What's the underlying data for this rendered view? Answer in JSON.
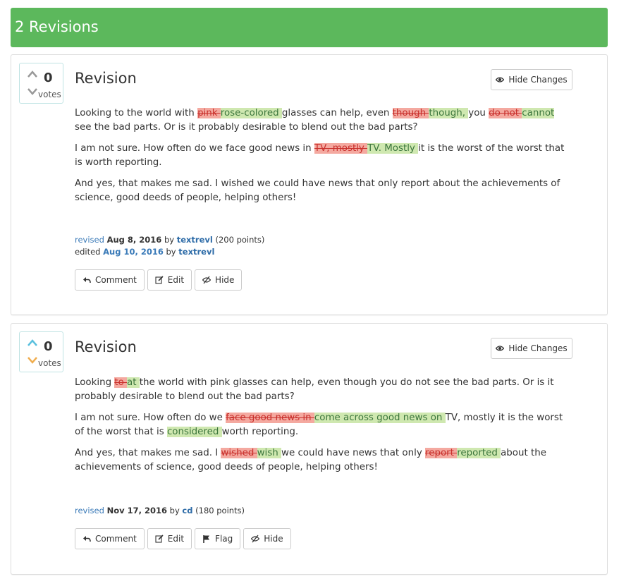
{
  "header": {
    "title": "2 Revisions"
  },
  "revisions": [
    {
      "votes": "0",
      "votes_label": "votes",
      "title": "Revision",
      "hide_changes": "Hide Changes",
      "p1": {
        "t1": "Looking to the world with ",
        "d1": "pink ",
        "i1": "rose-colored ",
        "t2": "glasses can help, even ",
        "d2": "though ",
        "i2": "though, ",
        "t3": "you ",
        "d3": "do not ",
        "i3": "cannot",
        "t4": " see the bad parts. Or is it probably desirable to blend out the bad parts?"
      },
      "p2": {
        "t1": "I am not sure. How often do we face good news in ",
        "d1": "TV, mostly ",
        "i1": "TV. Mostly ",
        "t2": "it is the worst of the worst that is worth reporting."
      },
      "p3": {
        "t1": "And yes, that makes me sad. I wished we could have news that only report about the achievements of science, good deeds of people, helping others!"
      },
      "meta": {
        "revised_label": "revised",
        "revised_date": "Aug 8, 2016",
        "by1": "by",
        "revised_user": "textrevl",
        "revised_points": "(200 points)",
        "edited_label": "edited",
        "edited_date": "Aug 10, 2016",
        "by2": "by",
        "edited_user": "textrevl"
      },
      "actions": {
        "comment": "Comment",
        "edit": "Edit",
        "hide": "Hide"
      }
    },
    {
      "votes": "0",
      "votes_label": "votes",
      "title": "Revision",
      "hide_changes": "Hide Changes",
      "p1": {
        "t1": "Looking ",
        "d1": "to ",
        "i1": "at ",
        "t2": "the world with pink glasses can help, even though you do not see the bad parts. Or is it probably desirable to blend out the bad parts?"
      },
      "p2": {
        "t1": "I am not sure. How often do we ",
        "d1": "face good news in ",
        "i1": "come across good news on ",
        "t2": "TV, mostly it is the worst of the worst that is ",
        "i2": "considered ",
        "t3": "worth reporting."
      },
      "p3": {
        "t1": "And yes, that makes me sad. I ",
        "d1": "wished ",
        "i1": "wish ",
        "t2": "we could have news that only ",
        "d2": "report ",
        "i2": "reported ",
        "t3": "about the achievements of science, good deeds of people, helping others!"
      },
      "meta": {
        "revised_label": "revised",
        "revised_date": "Nov 17, 2016",
        "by1": "by",
        "revised_user": "cd",
        "revised_points": "(180 points)"
      },
      "actions": {
        "comment": "Comment",
        "edit": "Edit",
        "flag": "Flag",
        "hide": "Hide"
      }
    }
  ],
  "colors": {
    "header": "#5cb85c",
    "deleted": "#f4a9a0",
    "inserted": "#cfe8b0",
    "link": "#3a7ab8",
    "upvote": "#5bc0de",
    "downvote": "#f0ad4e"
  },
  "icons": [
    "chevron-up-icon",
    "chevron-down-icon",
    "eye-icon",
    "reply-icon",
    "edit-icon",
    "eye-slash-icon",
    "flag-icon"
  ]
}
